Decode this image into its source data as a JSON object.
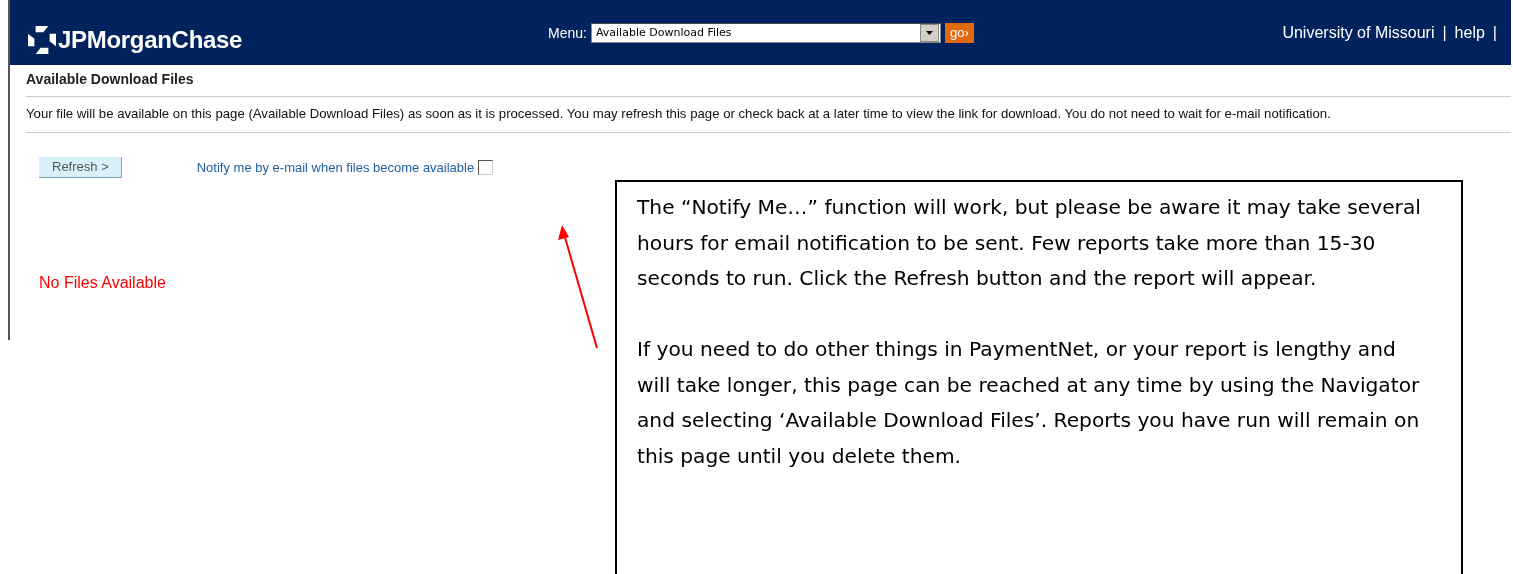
{
  "header": {
    "brand": "JPMorganChase",
    "menu_label": "Menu:",
    "menu_value": "Available Download Files",
    "go_button": "go›",
    "links": [
      "University of Missouri",
      "|",
      "help",
      "|"
    ]
  },
  "page_title": "Available Download Files",
  "intro": "Your file will be available on this page (Available Download Files) as soon as it is processed. You may refresh this page or check back at a later time to view the link for download. You do not need to wait for e-mail notification.",
  "refresh_button": "Refresh >",
  "notify": {
    "label": "Notify me by e-mail when files become available",
    "checked": false
  },
  "status": "No Files Available",
  "callout": {
    "paragraphs": [
      "The “Notify Me…” function will work, but please be aware it may take several hours for email notification to be sent.  Few reports take more than 15-30 seconds to run.  Click the Refresh button and the report will appear.",
      "If you need to do other things in PaymentNet, or your report is lengthy and will take longer, this page can be reached at any time by using the Navigator and selecting ‘Available Download Files’.  Reports you have run will remain on this page until you delete them."
    ]
  }
}
